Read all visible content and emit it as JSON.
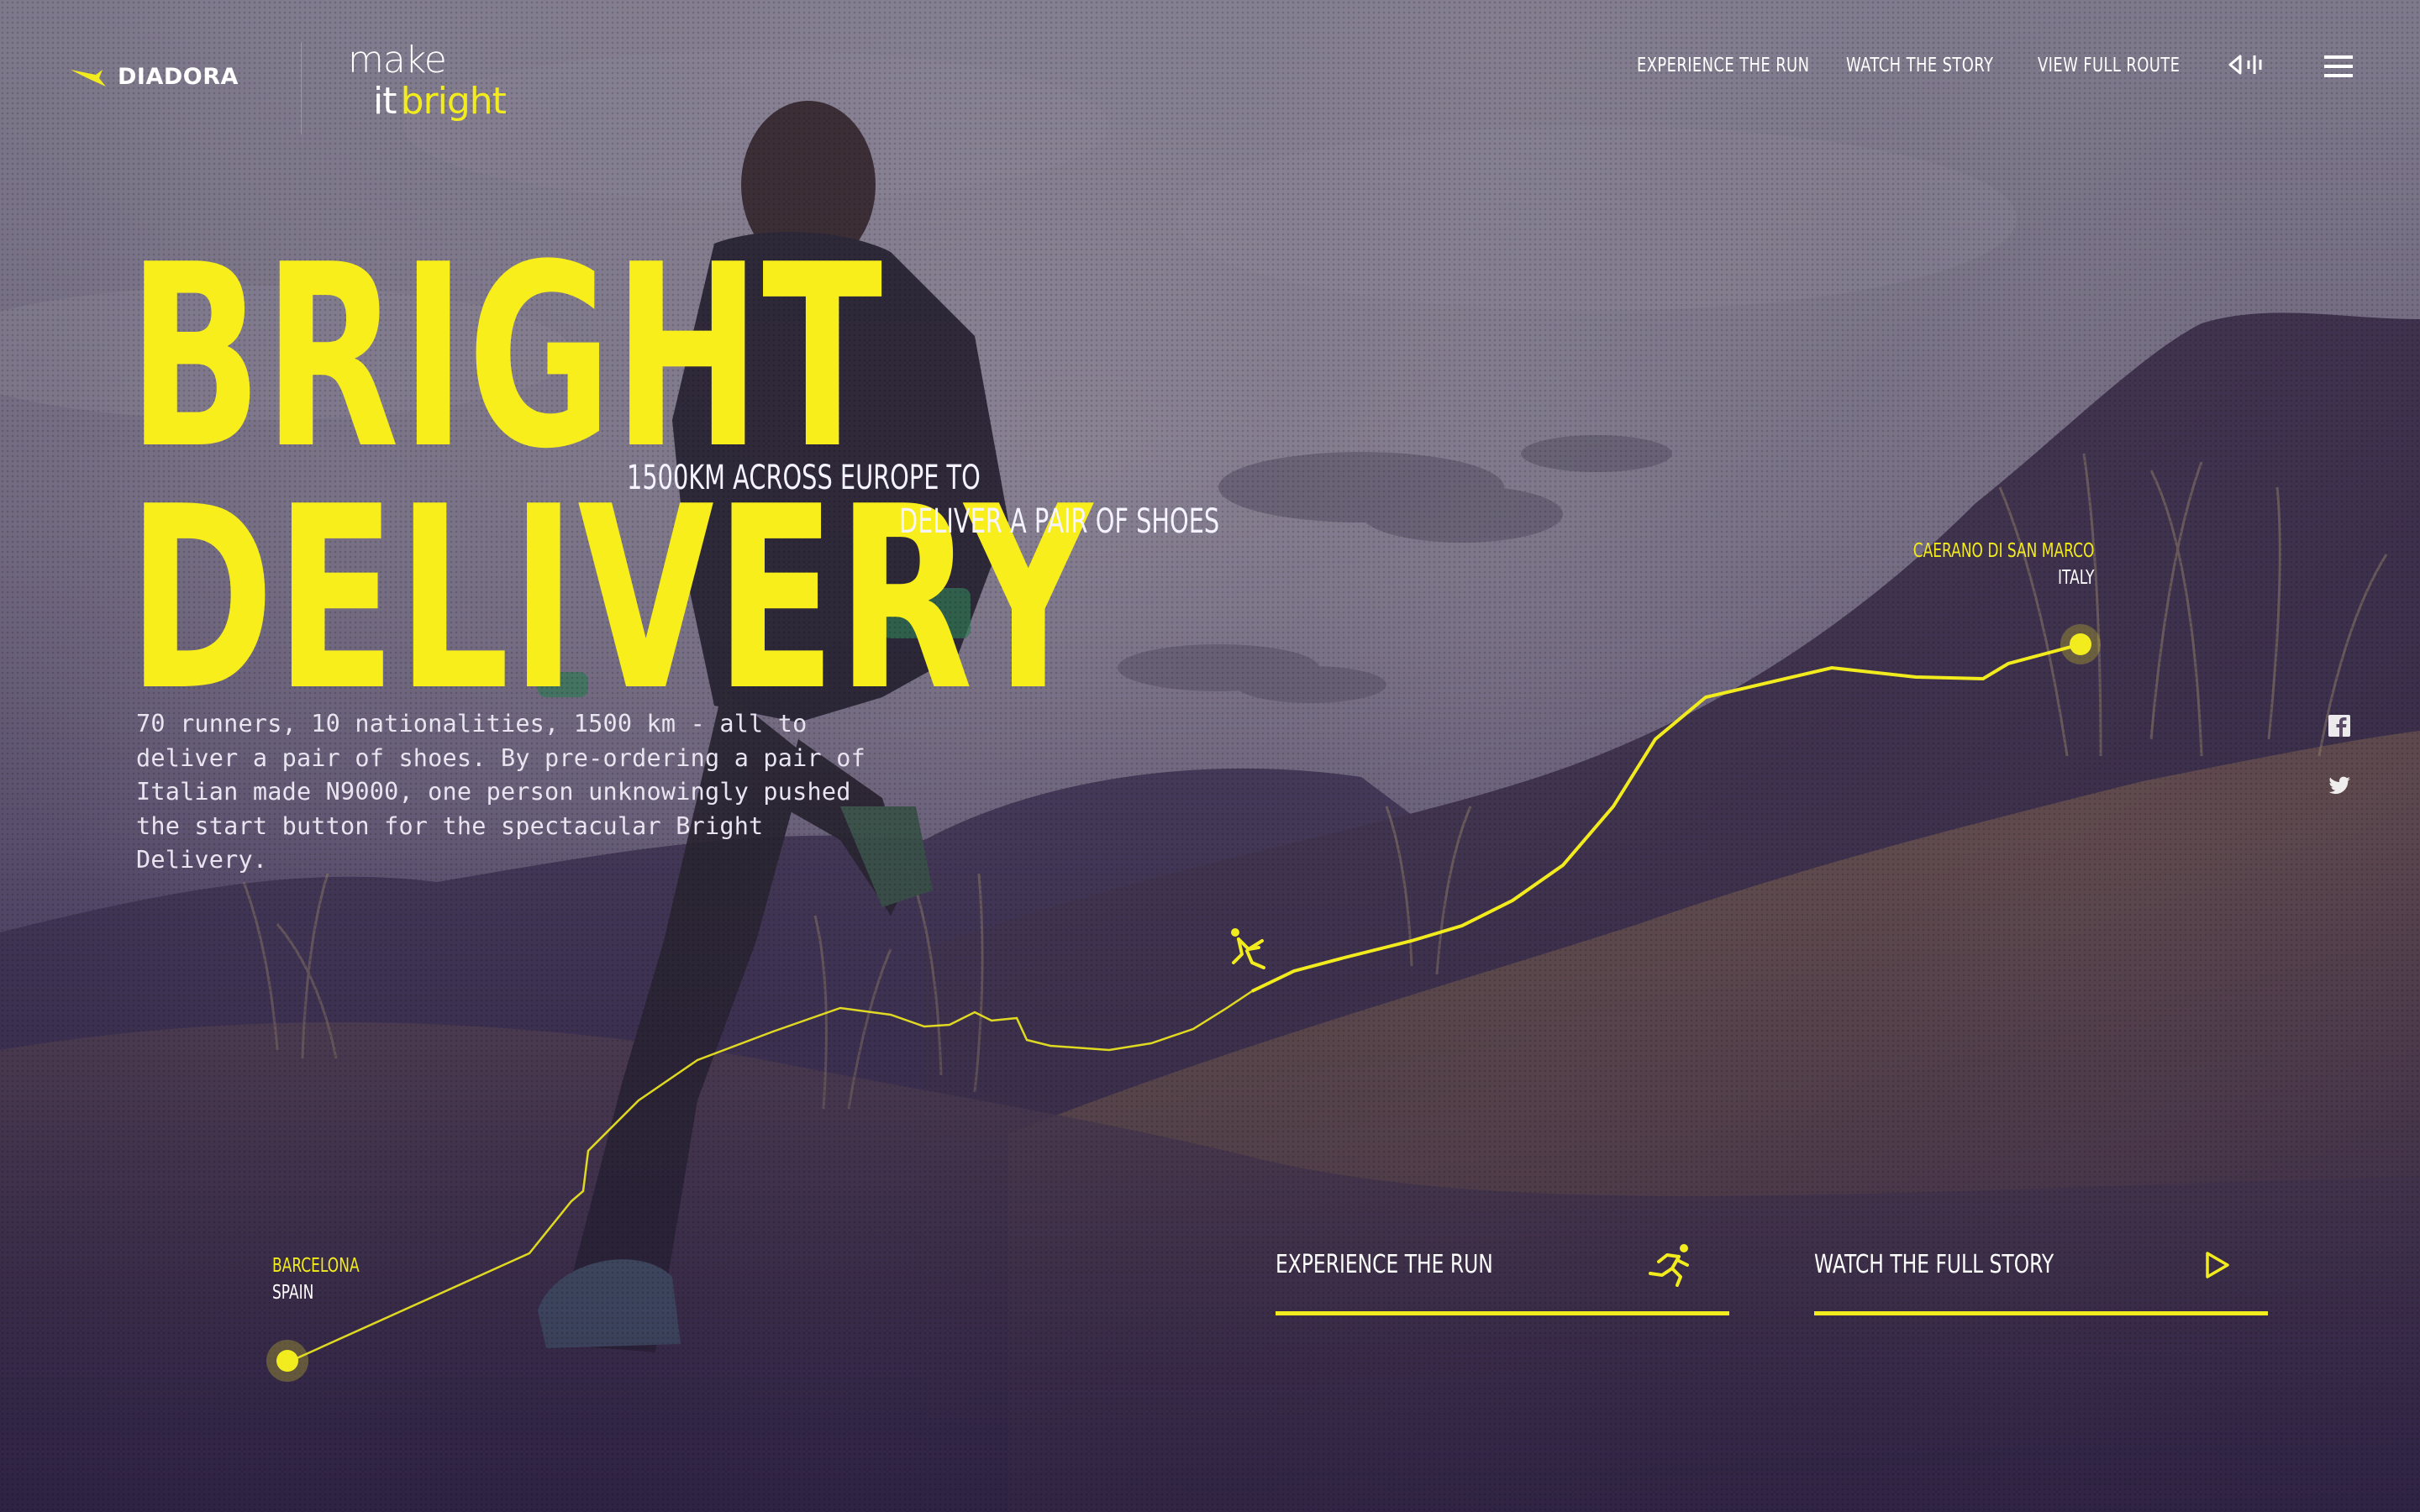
{
  "brand": {
    "diadora": "DIADORA",
    "campaign_make": "make",
    "campaign_it": "it",
    "campaign_bright": "bright",
    "accent_color": "#f2ec1e"
  },
  "nav": {
    "links": [
      "EXPERIENCE THE RUN",
      "WATCH THE STORY",
      "VIEW FULL ROUTE"
    ],
    "sound_icon": "speaker-icon",
    "menu_icon": "hamburger-menu-icon"
  },
  "hero": {
    "title_line1": "BRIGHT",
    "title_line2": "DELIVERY",
    "subtitle_line1": "1500KM ACROSS EUROPE TO",
    "subtitle_line2": "DELIVER A PAIR OF SHOES",
    "intro_lines": [
      "70 runners, 10 nationalities, 1500 km - all to",
      "deliver a pair of shoes. By pre-ordering a pair of",
      "Italian made N9000, one person unknowingly pushed",
      "the start button for the spectacular Bright",
      "Delivery."
    ]
  },
  "route": {
    "start": {
      "city": "BARCELONA",
      "country": "SPAIN"
    },
    "end": {
      "city": "CAERANO DI SAN MARCO",
      "country": "ITALY"
    },
    "runner_icon": "runner-icon"
  },
  "social": [
    "facebook-icon",
    "twitter-icon"
  ],
  "cta": {
    "experience": {
      "label": "EXPERIENCE THE RUN",
      "icon": "runner-icon"
    },
    "watch": {
      "label": "WATCH THE FULL STORY",
      "icon": "play-icon"
    }
  }
}
